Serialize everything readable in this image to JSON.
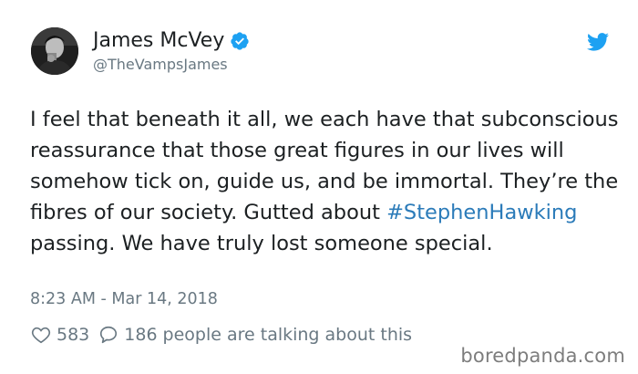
{
  "author": {
    "name": "James McVey",
    "handle": "@TheVampsJames",
    "verified": true,
    "avatar_icon": "profile-photo"
  },
  "tweet": {
    "text_before": "I feel that beneath it all, we each have that subconscious reassurance that those great figures in our lives will somehow tick on, guide us, and be immortal. They’re the fibres of our society. Gutted about ",
    "hashtag": "#StephenHawking",
    "text_after": " passing. We have truly lost someone special.",
    "timestamp": "8:23 AM - Mar 14, 2018"
  },
  "engagement": {
    "likes": "583",
    "replies": "186",
    "talking_label": "people are talking about this"
  },
  "watermark": "boredpanda.com",
  "colors": {
    "accent": "#1da1f2",
    "hashtag": "#2b7bb9",
    "muted": "#697882",
    "text": "#1c2022"
  },
  "icons": {
    "brand": "twitter-bird-icon",
    "verified": "verified-badge-icon",
    "like": "heart-icon",
    "reply": "speech-bubble-icon"
  }
}
